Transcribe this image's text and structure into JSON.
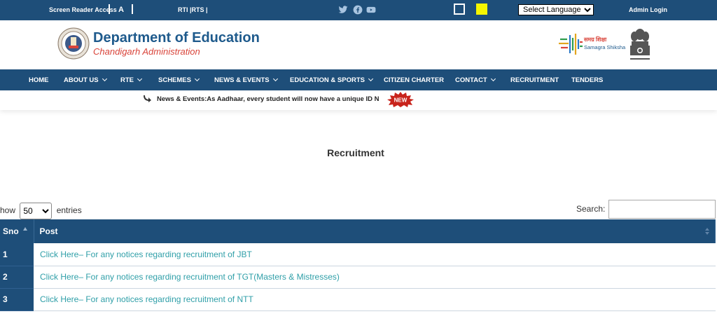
{
  "topbar": {
    "screen_reader": "Screen Reader Access",
    "font_size": "A",
    "rti_rts": "RTI |RTS |",
    "language_select": "Select Language",
    "admin_login": "Admin Login",
    "social_icons": [
      "twitter-icon",
      "facebook-icon",
      "youtube-icon"
    ],
    "contrast_colors": [
      "#1e4e79",
      "#f6f600"
    ]
  },
  "header": {
    "title": "Department of Education",
    "subtitle": "Chandigarh Administration",
    "samagra_hindi": "समग्र शिक्षा",
    "samagra_english": "Samagra Shiksha"
  },
  "nav": {
    "items": [
      {
        "label": "HOME",
        "dropdown": false
      },
      {
        "label": "ABOUT US",
        "dropdown": true
      },
      {
        "label": "RTE",
        "dropdown": true
      },
      {
        "label": "SCHEMES",
        "dropdown": true
      },
      {
        "label": "NEWS & EVENTS",
        "dropdown": true
      },
      {
        "label": "EDUCATION & SPORTS",
        "dropdown": true
      },
      {
        "label": "CITIZEN CHARTER",
        "dropdown": false
      },
      {
        "label": "CONTACT",
        "dropdown": true
      },
      {
        "label": "RECRUITMENT",
        "dropdown": false
      },
      {
        "label": "TENDERS",
        "dropdown": false
      }
    ]
  },
  "ticker": {
    "text": "News & Events:As Aadhaar, every student will now have a unique ID N",
    "badge": "NEW"
  },
  "main": {
    "title": "Recruitment",
    "show_prefix": "how",
    "entries_value": "50",
    "show_suffix": "entries",
    "search_label": "Search:",
    "search_value": "",
    "columns": [
      "Sno",
      "Post"
    ],
    "rows": [
      {
        "sno": "1",
        "post": "Click Here– For any notices regarding recruitment of JBT"
      },
      {
        "sno": "2",
        "post": "Click Here– For any notices regarding recruitment of TGT(Masters & Mistresses)"
      },
      {
        "sno": "3",
        "post": "Click Here– For any notices regarding recruitment of NTT"
      }
    ]
  },
  "colors": {
    "primary": "#1e4e79",
    "link": "#2f9fa8",
    "accent_red": "#d9443a"
  }
}
